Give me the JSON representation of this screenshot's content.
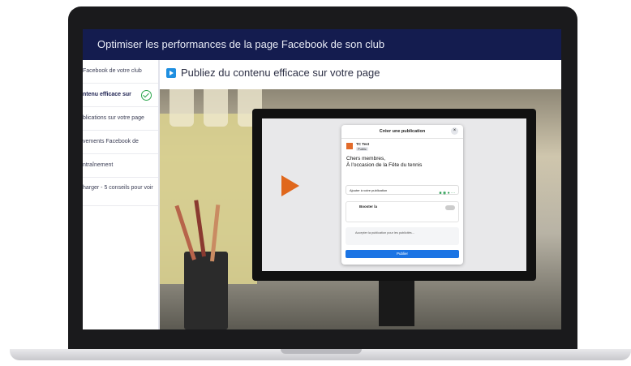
{
  "header": {
    "title": "Optimiser les performances de la page Facebook de son club"
  },
  "sidebar": {
    "items": [
      {
        "label": "Facebook de votre club"
      },
      {
        "label": "ntenu efficace sur"
      },
      {
        "label": "blications sur votre page"
      },
      {
        "label": "vements Facebook de"
      },
      {
        "label": "ntraînement"
      },
      {
        "label": "harger - 5 conseils pour\nvoir"
      }
    ]
  },
  "main": {
    "section_title": "Publiez du contenu efficace sur votre page"
  },
  "dialog": {
    "title": "Créer une publication",
    "close": "×",
    "user": "TC Test",
    "audience": "Public",
    "text_line1": "Chers membres,",
    "text_line2": "À l'occasion de la Fête du tennis",
    "add_to_post": "Ajouter à votre publication",
    "add_icons": "■ ◉ ● ···",
    "boost_label": "Booster la",
    "info_text": "Accepter la publication pour les publicités...",
    "publish": "Publier"
  },
  "colors": {
    "header": "#141c4f",
    "accent": "#1f8fe0",
    "check": "#2aa54b",
    "play": "#e0671c"
  }
}
